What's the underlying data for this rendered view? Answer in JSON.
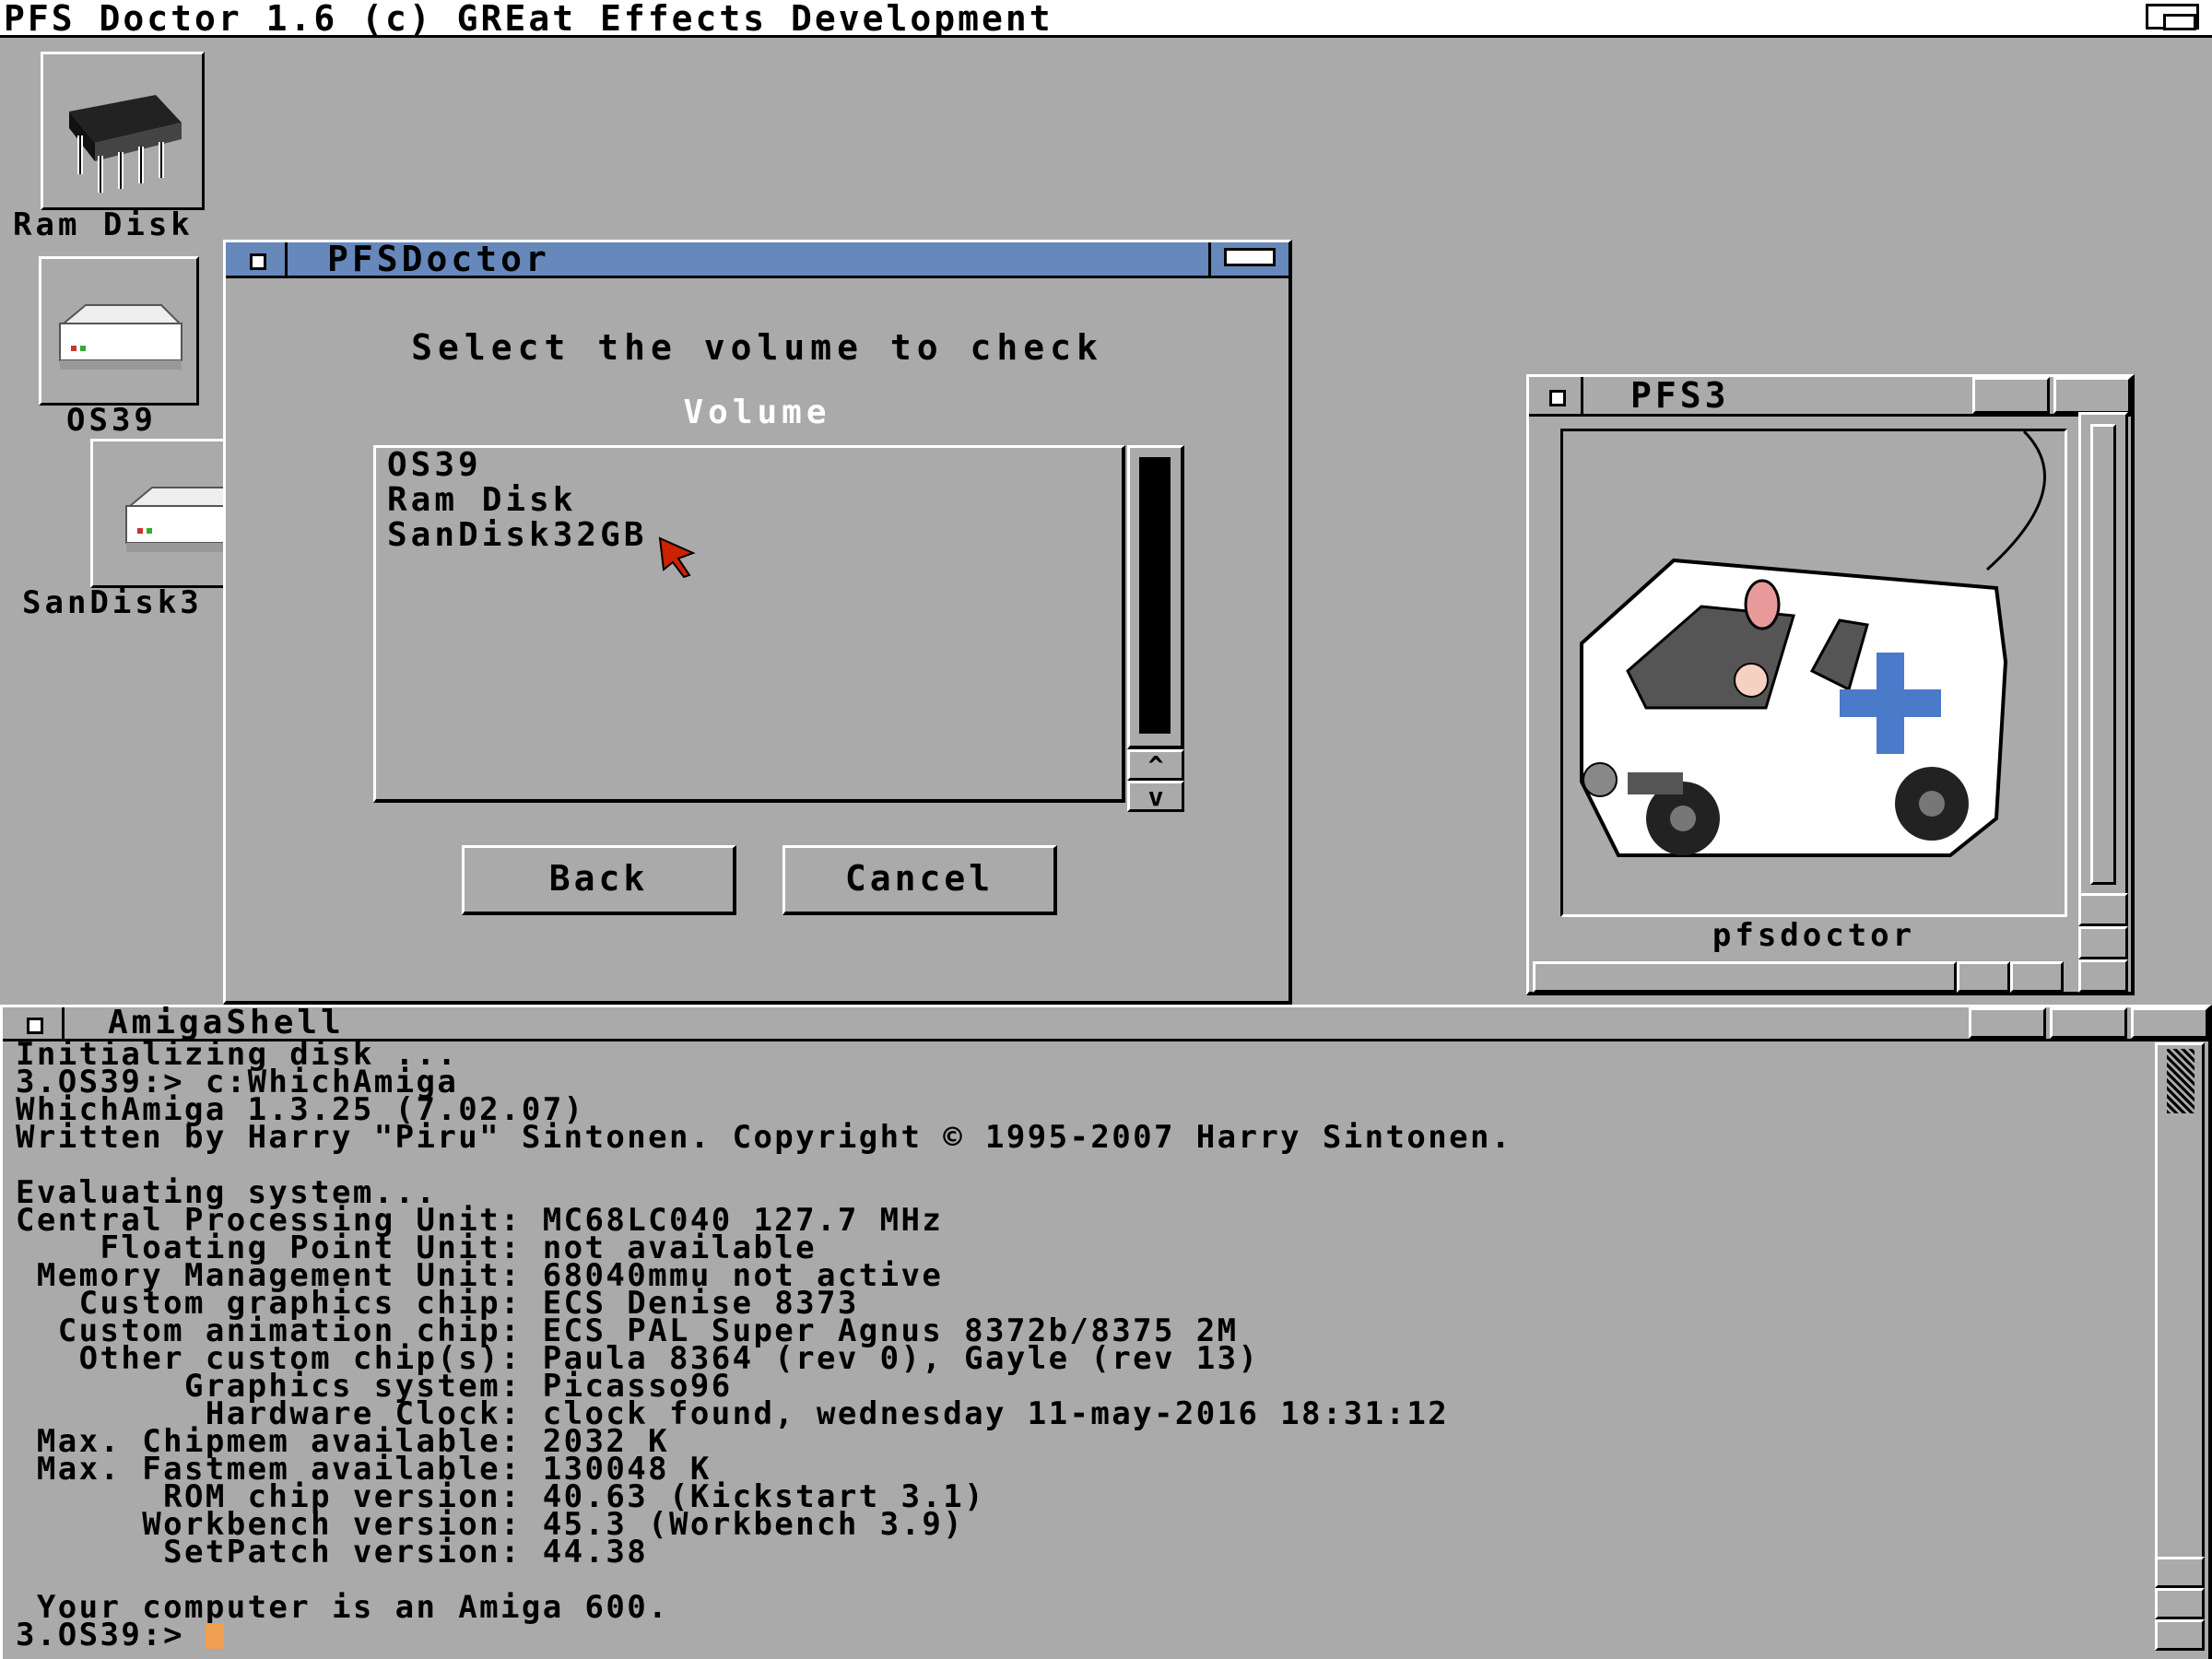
{
  "screen": {
    "title": "PFS Doctor 1.6 (c) GREat Effects Development"
  },
  "desktop_icons": [
    {
      "label": "Ram Disk",
      "icon": "chip-icon"
    },
    {
      "label": "OS39",
      "icon": "harddisk-icon"
    },
    {
      "label": "SanDisk3",
      "icon": "harddisk-icon"
    }
  ],
  "dialog": {
    "title": "PFSDoctor",
    "heading": "Select the volume to check",
    "list_label": "Volume",
    "volumes": [
      "OS39",
      "Ram Disk",
      "SanDisk32GB"
    ],
    "back_label": "Back",
    "cancel_label": "Cancel"
  },
  "drawer": {
    "title": "PFS3",
    "item_label": "pfsdoctor",
    "item_icon": "ambulance-icon"
  },
  "shell": {
    "title": "AmigaShell",
    "lines": [
      "Initializing disk ...",
      "3.OS39:> c:WhichAmiga",
      "WhichAmiga 1.3.25 (7.02.07)",
      "Written by Harry \"Piru\" Sintonen. Copyright © 1995-2007 Harry Sintonen.",
      "",
      "Evaluating system...",
      "Central Processing Unit: MC68LC040 127.7 MHz",
      "    Floating Point Unit: not available",
      " Memory Management Unit: 68040mmu not active",
      "   Custom graphics chip: ECS Denise 8373",
      "  Custom animation chip: ECS PAL Super Agnus 8372b/8375 2M",
      "   Other custom chip(s): Paula 8364 (rev 0), Gayle (rev 13)",
      "        Graphics system: Picasso96",
      "         Hardware Clock: clock found, wednesday 11-may-2016 18:31:12",
      " Max. Chipmem available: 2032 K",
      " Max. Fastmem available: 130048 K",
      "       ROM chip version: 40.63 (Kickstart 3.1)",
      "      Workbench version: 45.3 (Workbench 3.9)",
      "       SetPatch version: 44.38",
      "",
      " Your computer is an Amiga 600."
    ],
    "prompt": "3.OS39:> "
  },
  "colors": {
    "background": "#aaaaaa",
    "active_title": "#6688bb",
    "white": "#ffffff",
    "black": "#000000",
    "cursor": "#f0a050",
    "pointer": "#cc2200"
  }
}
